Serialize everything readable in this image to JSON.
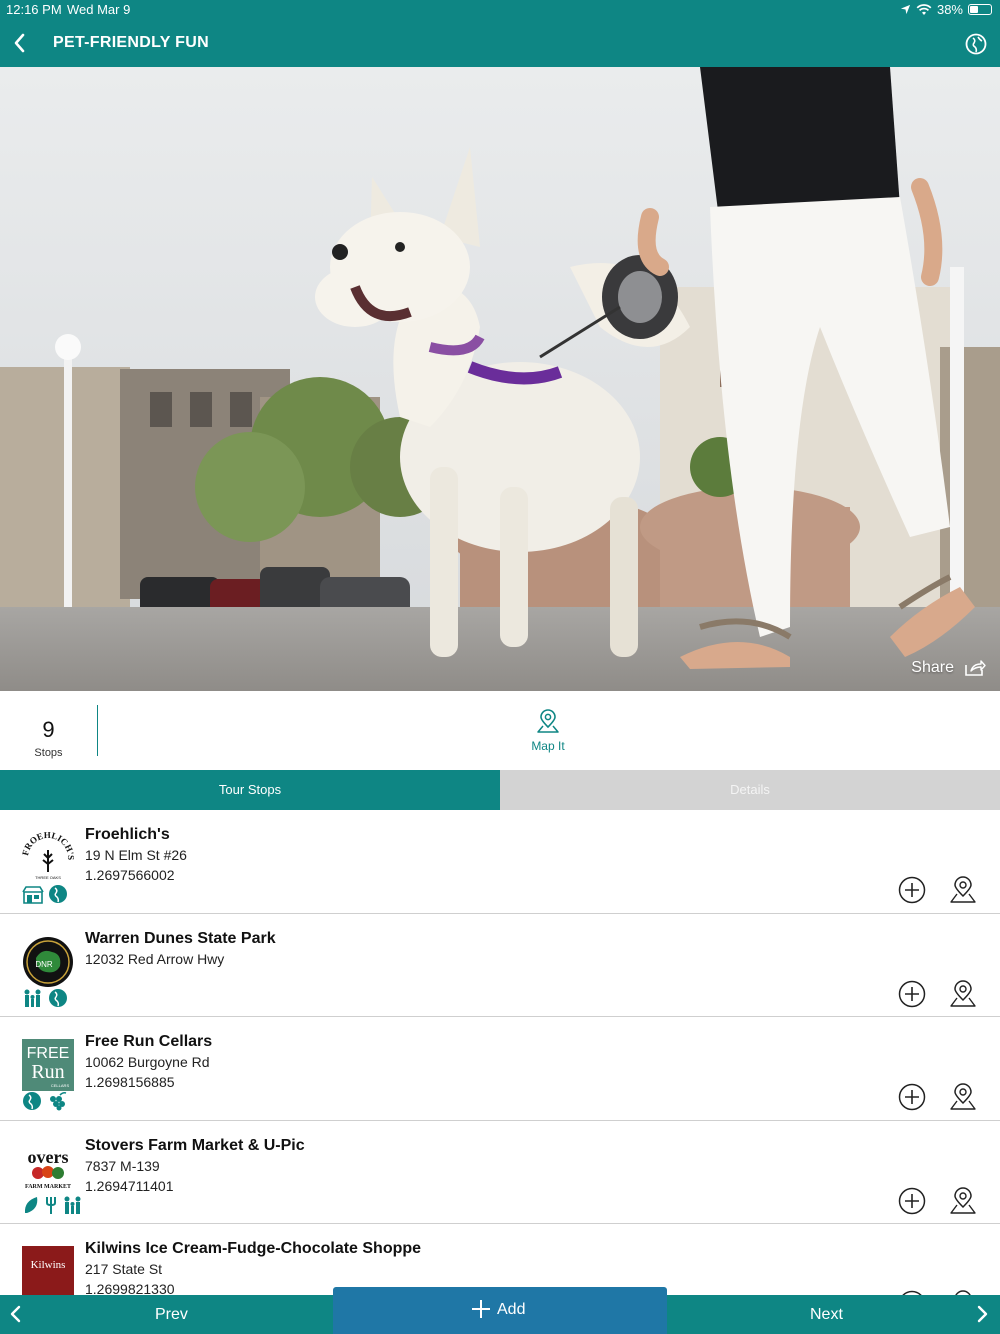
{
  "status": {
    "time": "12:16 PM",
    "date": "Wed Mar 9",
    "battery": "38%",
    "battery_level": 0.38
  },
  "nav": {
    "title": "PET-FRIENDLY FUN"
  },
  "hero": {
    "share_label": "Share"
  },
  "summary": {
    "stops_count": "9",
    "stops_label": "Stops",
    "map_label": "Map It"
  },
  "tabs": [
    {
      "label": "Tour Stops",
      "active": true
    },
    {
      "label": "Details",
      "active": false
    }
  ],
  "stops": [
    {
      "name": "Froehlich's",
      "address": "19 N Elm St #26",
      "phone": "1.2697566002",
      "icons": [
        "shop-icon",
        "globe-icon"
      ]
    },
    {
      "name": "Warren Dunes State Park",
      "address": "12032 Red Arrow Hwy",
      "phone": "",
      "icons": [
        "family-icon",
        "globe-icon"
      ]
    },
    {
      "name": "Free Run Cellars",
      "address": "10062 Burgoyne Rd",
      "phone": "1.2698156885",
      "icons": [
        "globe-icon",
        "grapes-icon"
      ]
    },
    {
      "name": "Stovers Farm Market & U-Pic",
      "address": "7837 M-139",
      "phone": "1.2694711401",
      "icons": [
        "leaf-icon",
        "fork-icon",
        "family-icon"
      ]
    },
    {
      "name": "Kilwins Ice Cream-Fudge-Chocolate Shoppe",
      "address": "217 State St",
      "phone": "1.2699821330",
      "icons": []
    }
  ],
  "logos": {
    "froehlichs": "FROEHLICH'S",
    "froehlichs_sub": "THREE OAKS",
    "dnr": "DNR",
    "freerun_top": "FREE",
    "freerun_bottom": "Run",
    "freerun_sub": "CELLARS",
    "stovers_top": "overs",
    "stovers_sub": "FARM MARKET",
    "kilwins": "Kilwins"
  },
  "bottom": {
    "prev_label": "Prev",
    "add_label": "Add",
    "next_label": "Next"
  },
  "colors": {
    "teal": "#0e8684",
    "add_blue": "#1f77a6",
    "tab_inactive": "#d3d3d3"
  }
}
